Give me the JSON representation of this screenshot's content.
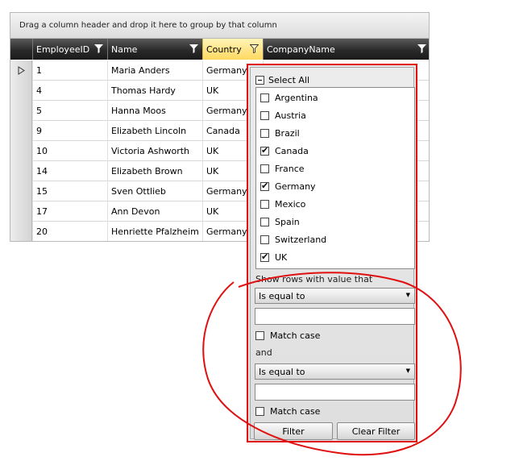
{
  "grid": {
    "group_panel_text": "Drag a column header and drop it here to group by that column",
    "columns": [
      {
        "label": "EmployeeID",
        "name": "employeeid"
      },
      {
        "label": "Name",
        "name": "name"
      },
      {
        "label": "Country",
        "name": "country"
      },
      {
        "label": "CompanyName",
        "name": "companyname"
      }
    ],
    "rows": [
      {
        "id": "1",
        "name": "Maria Anders",
        "country": "Germany",
        "company": ""
      },
      {
        "id": "4",
        "name": "Thomas Hardy",
        "country": "UK",
        "company": ""
      },
      {
        "id": "5",
        "name": "Hanna Moos",
        "country": "Germany",
        "company": ""
      },
      {
        "id": "9",
        "name": "Elizabeth Lincoln",
        "country": "Canada",
        "company": ""
      },
      {
        "id": "10",
        "name": "Victoria Ashworth",
        "country": "UK",
        "company": ""
      },
      {
        "id": "14",
        "name": "Elizabeth Brown",
        "country": "UK",
        "company": ""
      },
      {
        "id": "15",
        "name": "Sven Ottlieb",
        "country": "Germany",
        "company": ""
      },
      {
        "id": "17",
        "name": "Ann Devon",
        "country": "UK",
        "company": ""
      },
      {
        "id": "20",
        "name": "Henriette Pfalzheim",
        "country": "Germany",
        "company": ""
      }
    ]
  },
  "filter_popup": {
    "select_all_label": "Select All",
    "values": [
      {
        "label": "Argentina",
        "checked": false
      },
      {
        "label": "Austria",
        "checked": false
      },
      {
        "label": "Brazil",
        "checked": false
      },
      {
        "label": "Canada",
        "checked": true
      },
      {
        "label": "France",
        "checked": false
      },
      {
        "label": "Germany",
        "checked": true
      },
      {
        "label": "Mexico",
        "checked": false
      },
      {
        "label": "Spain",
        "checked": false
      },
      {
        "label": "Switzerland",
        "checked": false
      },
      {
        "label": "UK",
        "checked": true
      }
    ],
    "show_rows_label": "Show rows with value that",
    "operator1": "Is equal to",
    "value1": "",
    "match_case1_label": "Match case",
    "logical_label": "and",
    "operator2": "Is equal to",
    "value2": "",
    "match_case2_label": "Match case",
    "filter_button": "Filter",
    "clear_filter_button": "Clear Filter"
  },
  "colors": {
    "annotation": "#e01010",
    "active_header": "#ffd860"
  }
}
